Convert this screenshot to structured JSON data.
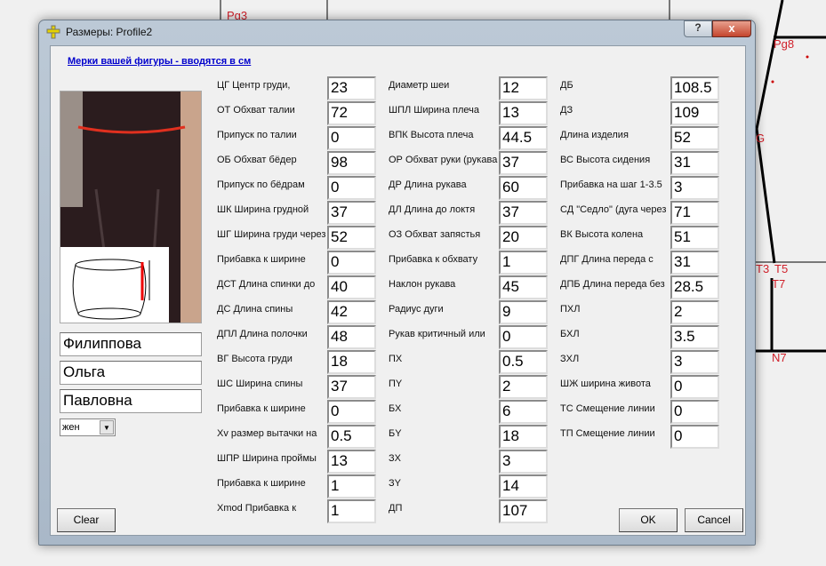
{
  "background": {
    "labels": [
      "Pg3",
      "Pg8",
      "G",
      "T3",
      "T5",
      "T7",
      "N7"
    ]
  },
  "window": {
    "title": "Размеры:  Profile2",
    "help": "?",
    "close": "x"
  },
  "heading": "Мерки вашей фигуры - вводятся в см",
  "person": {
    "surname": "Филиппова",
    "name": "Ольга",
    "patronymic": "Павловна",
    "gender": "жен"
  },
  "buttons": {
    "clear": "Clear",
    "ok": "OK",
    "cancel": "Cancel"
  },
  "columns": [
    [
      {
        "label": "ЦГ Центр груди,",
        "value": "23"
      },
      {
        "label": "ОТ Обхват талии",
        "value": "72"
      },
      {
        "label": "Припуск по талии",
        "value": "0"
      },
      {
        "label": "ОБ Обхват бёдер",
        "value": "98"
      },
      {
        "label": "Припуск по бёдрам",
        "value": "0"
      },
      {
        "label": "ШК Ширина грудной",
        "value": "37"
      },
      {
        "label": "ШГ Ширина груди через",
        "value": "52"
      },
      {
        "label": "Прибавка к ширине",
        "value": "0"
      },
      {
        "label": "ДСТ Длина спинки до",
        "value": "40"
      },
      {
        "label": "ДС Длина спины",
        "value": "42"
      },
      {
        "label": "ДПЛ Длина полочки",
        "value": "48"
      },
      {
        "label": "ВГ Высота груди",
        "value": "18"
      },
      {
        "label": "ШС Ширина спины",
        "value": "37"
      },
      {
        "label": "Прибавка к ширине",
        "value": "0"
      },
      {
        "label": "Xv размер вытачки на",
        "value": "0.5"
      },
      {
        "label": "ШПР Ширина проймы",
        "value": "13"
      },
      {
        "label": "Прибавка к ширине",
        "value": "1"
      },
      {
        "label": "Xmod Прибавка к",
        "value": "1"
      }
    ],
    [
      {
        "label": "Диаметр шеи",
        "value": "12"
      },
      {
        "label": "ШПЛ Ширина плеча",
        "value": "13"
      },
      {
        "label": "ВПК Высота плеча",
        "value": "44.5"
      },
      {
        "label": "ОР Обхват руки (рукава.",
        "value": "37"
      },
      {
        "label": "ДР Длина рукава",
        "value": "60"
      },
      {
        "label": "ДЛ Длина до локтя",
        "value": "37"
      },
      {
        "label": "ОЗ Обхват запястья",
        "value": "20"
      },
      {
        "label": "Прибавка к обхвату",
        "value": "1"
      },
      {
        "label": "Наклон рукава",
        "value": "45"
      },
      {
        "label": "Радиус дуги",
        "value": "9"
      },
      {
        "label": "Рукав критичный или",
        "value": "0"
      },
      {
        "label": "ПХ",
        "value": "0.5"
      },
      {
        "label": "ПY",
        "value": "2"
      },
      {
        "label": "БХ",
        "value": "6"
      },
      {
        "label": "БY",
        "value": "18"
      },
      {
        "label": "ЗХ",
        "value": "3"
      },
      {
        "label": "ЗY",
        "value": "14"
      },
      {
        "label": "ДП",
        "value": "107"
      }
    ],
    [
      {
        "label": "ДБ",
        "value": "108.5"
      },
      {
        "label": "ДЗ",
        "value": "109"
      },
      {
        "label": "Длина изделия",
        "value": "52"
      },
      {
        "label": "ВС Высота сидения",
        "value": "31"
      },
      {
        "label": "Прибавка на шаг 1-3.5",
        "value": "3"
      },
      {
        "label": "СД \"Седло\" (дуга через",
        "value": "71"
      },
      {
        "label": "ВК Высота колена",
        "value": "51"
      },
      {
        "label": "ДПГ Длина переда с",
        "value": "31"
      },
      {
        "label": "ДПБ Длина переда без",
        "value": "28.5"
      },
      {
        "label": "ПХЛ",
        "value": "2"
      },
      {
        "label": "БХЛ",
        "value": "3.5"
      },
      {
        "label": "ЗХЛ",
        "value": "3"
      },
      {
        "label": "ШЖ ширина живота",
        "value": "0"
      },
      {
        "label": "ТС Смещение линии",
        "value": "0"
      },
      {
        "label": "ТП Смещение линии",
        "value": "0"
      }
    ]
  ]
}
